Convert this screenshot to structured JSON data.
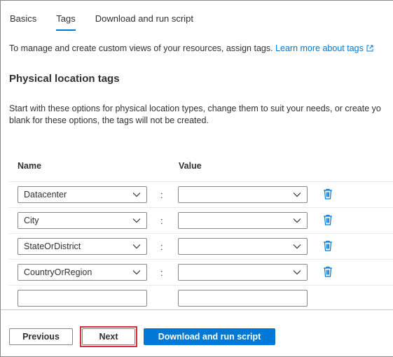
{
  "tabs": [
    {
      "label": "Basics",
      "active": false
    },
    {
      "label": "Tags",
      "active": true
    },
    {
      "label": "Download and run script",
      "active": false
    }
  ],
  "intro": {
    "text": "To manage and create custom views of your resources, assign tags.",
    "link": "Learn more about tags"
  },
  "section_title": "Physical location tags",
  "description": {
    "line1": "Start with these options for physical location types, change them to suit your needs, or create yo",
    "line2": "blank for these options, the tags will not be created."
  },
  "columns": {
    "name": "Name",
    "value": "Value"
  },
  "separator": ":",
  "rows": [
    {
      "name": "Datacenter",
      "value": ""
    },
    {
      "name": "City",
      "value": ""
    },
    {
      "name": "StateOrDistrict",
      "value": ""
    },
    {
      "name": "CountryOrRegion",
      "value": ""
    },
    {
      "name": "",
      "value": ""
    }
  ],
  "footer": {
    "previous": "Previous",
    "next": "Next",
    "download": "Download and run script"
  },
  "colors": {
    "accent": "#0078d4",
    "highlight": "#d13438",
    "text": "#323130"
  },
  "icons": {
    "delete": "trash-icon",
    "dropdown": "chevron-down-icon",
    "external": "external-link-icon"
  }
}
